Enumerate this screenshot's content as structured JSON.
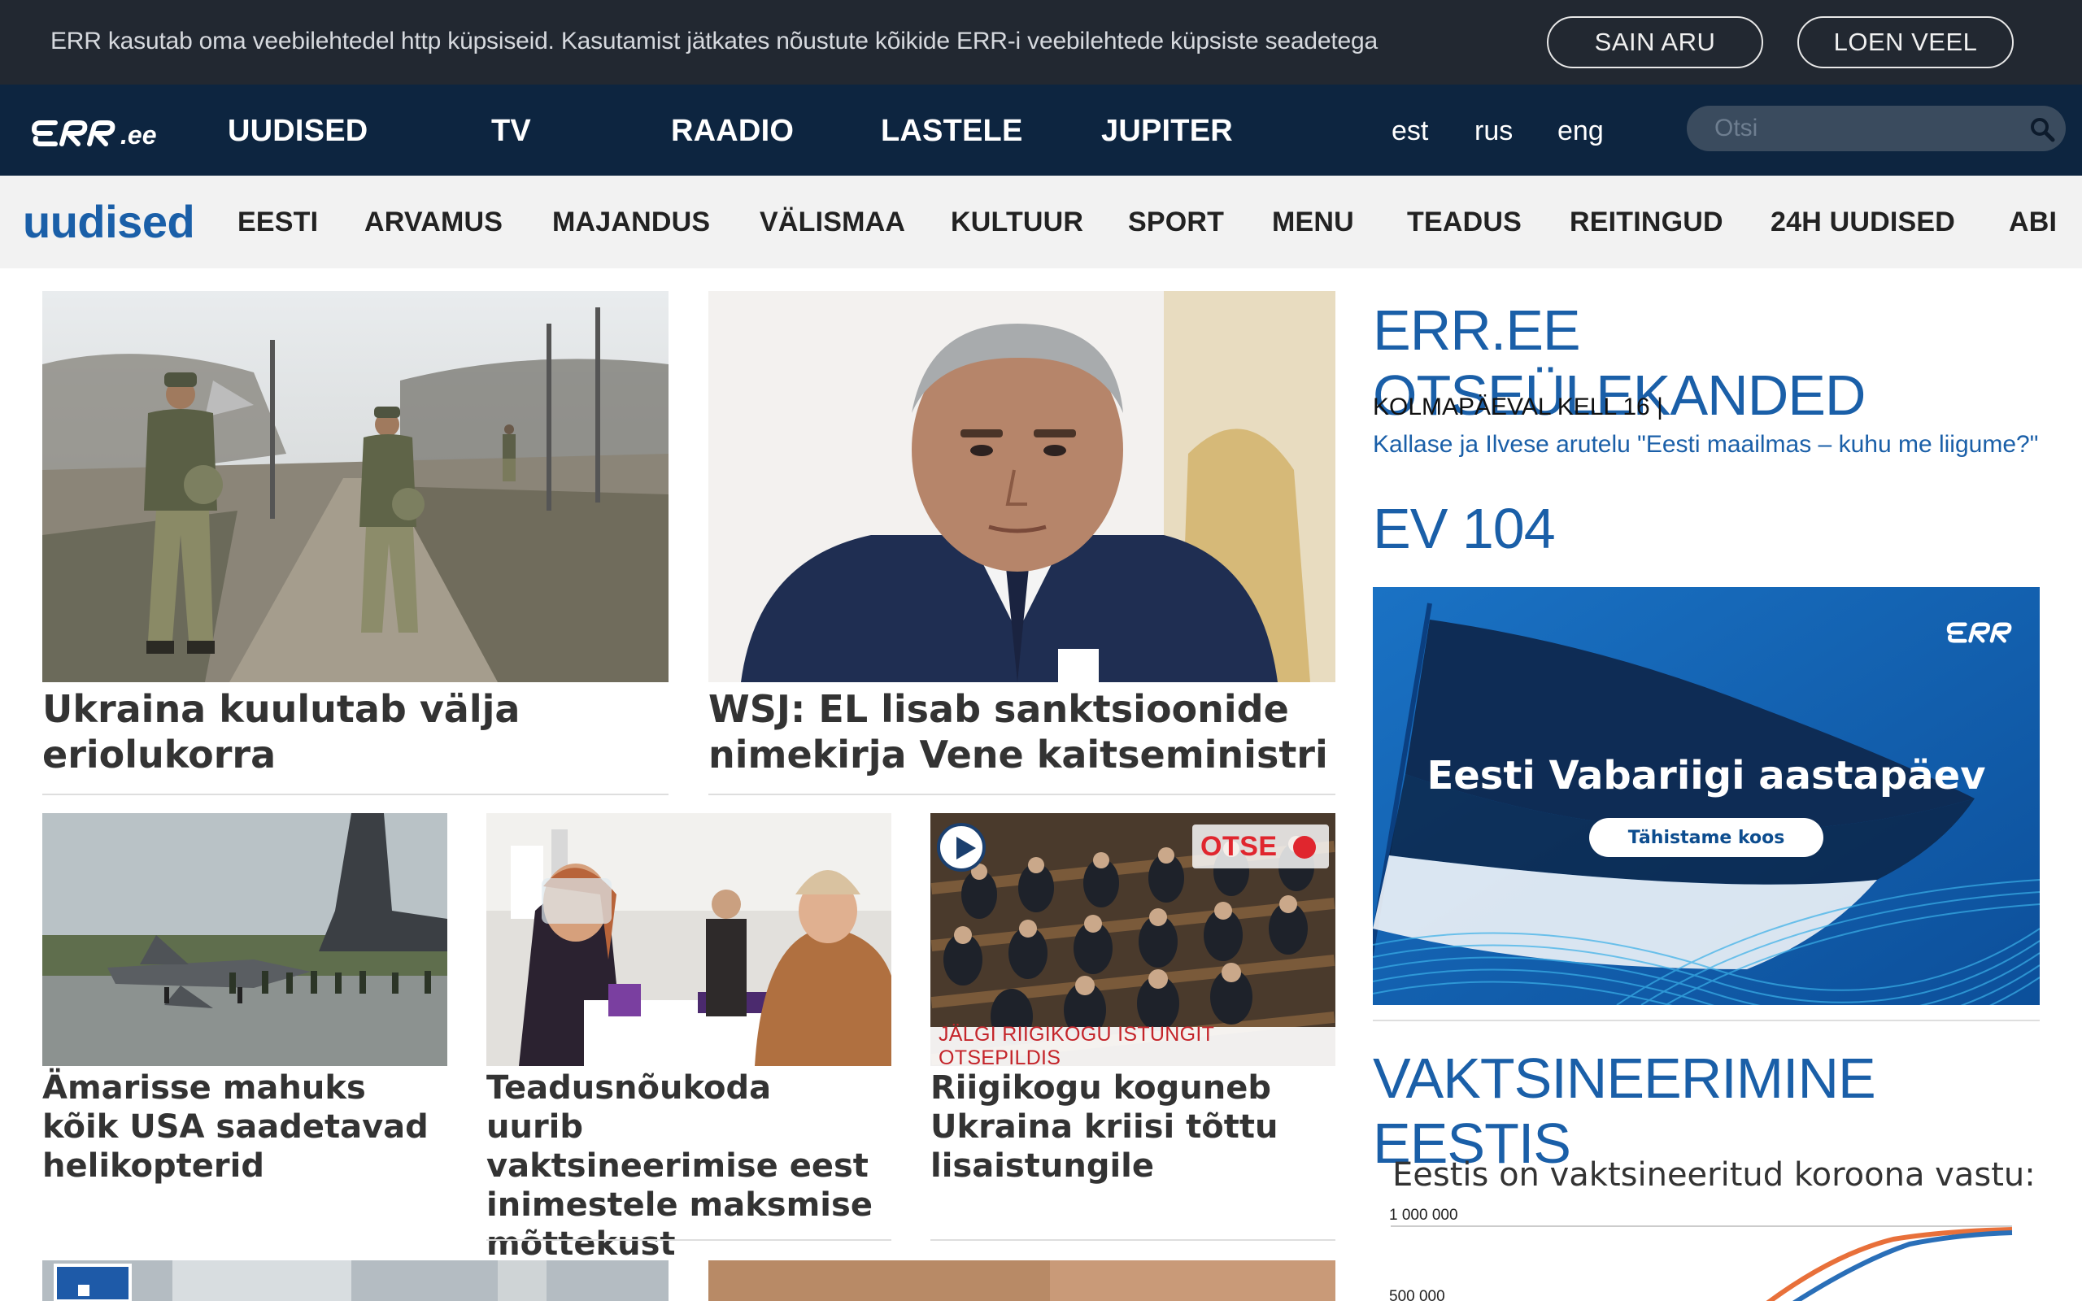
{
  "cookie": {
    "text": "ERR kasutab oma veebilehtedel http küpsiseid. Kasutamist jätkates nõustute kõikide ERR-i veebilehtede küpsiste seadetega",
    "accept_label": "SAIN ARU",
    "more_label": "LOEN VEEL"
  },
  "header": {
    "logo_suffix": ".ee",
    "nav": [
      "UUDISED",
      "TV",
      "RAADIO",
      "LASTELE",
      "JUPITER"
    ],
    "languages": [
      "est",
      "rus",
      "eng"
    ],
    "search_placeholder": "Otsi"
  },
  "section": {
    "logo": "uudised",
    "items": [
      "EESTI",
      "ARVAMUS",
      "MAJANDUS",
      "VÄLISMAA",
      "KULTUUR",
      "SPORT",
      "MENU",
      "TEADUS",
      "REITINGUD",
      "24H UUDISED",
      "ABI"
    ]
  },
  "articles": {
    "top": [
      {
        "title": "Ukraina kuulutab välja eriolukorra"
      },
      {
        "title": "WSJ: EL lisab sanktsioonide nimekirja Vene kaitseministri"
      }
    ],
    "row": [
      {
        "title": "Ämarisse mahuks kõik USA saadetavad helikopterid"
      },
      {
        "title": "Teadusnõukoda uurib vaktsineerimise eest inimestele maksmise mõttekust"
      },
      {
        "title": "Riigikogu koguneb Ukraina kriisi tõttu lisaistungile",
        "live_label": "OTSE",
        "caption": "JÄLGI RIIGIKOGU ISTUNGIT OTSEPILDIS"
      }
    ]
  },
  "sidebar": {
    "live_heading": "ERR.EE OTSEÜLEKANDED",
    "live_time": "KOLMAPÄEVAL KELL 16 |",
    "live_link": "Kallase ja Ilvese arutelu \"Eesti maailmas – kuhu me liigume?\"",
    "ev_heading": "EV 104",
    "banner_title": "Eesti Vabariigi aastapäev",
    "banner_button": "Tähistame koos",
    "vacc_heading": "VAKTSINEERIMINE EESTIS",
    "chart_title": "Eestis on vaktsineeritud koroona vastu:"
  },
  "chart_data": {
    "type": "line",
    "title": "Eestis on vaktsineeritud koroona vastu:",
    "y_tick_labels": [
      "1 000 000",
      "500 000"
    ],
    "series": [
      {
        "color": "#e8703a"
      },
      {
        "color": "#2a6fb8"
      }
    ]
  },
  "colors": {
    "cookie_bg": "#222831",
    "nav_bg": "#0d2540",
    "section_bg": "#f2f2f2",
    "accent_blue": "#1a5fa8",
    "live_red": "#e0262e"
  }
}
